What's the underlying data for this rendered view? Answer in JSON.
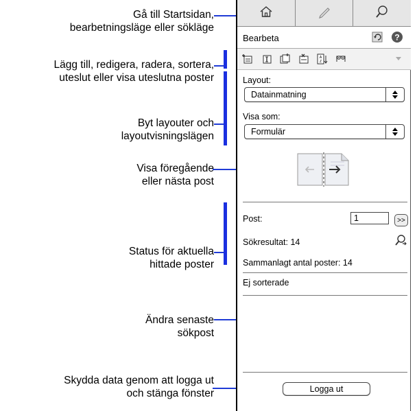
{
  "callouts": {
    "nav": [
      "Gå till Startsidan,",
      "bearbetningsläge eller sökläge"
    ],
    "records": [
      "Lägg till, redigera, radera, sortera,",
      "uteslut eller visa uteslutna poster"
    ],
    "layouts": [
      "Byt layouter och",
      "layoutvisningslägen"
    ],
    "book": [
      "Visa föregående",
      "eller nästa post"
    ],
    "status": [
      "Status för aktuella",
      "hittade poster"
    ],
    "modify": [
      "Ändra senaste",
      "sökpost"
    ],
    "logout": [
      "Skydda data genom att logga ut",
      "och stänga fönster"
    ]
  },
  "nav": {
    "icons": [
      "home-icon",
      "pencil-icon",
      "magnifier-icon"
    ]
  },
  "header": {
    "title": "Bearbeta",
    "icons": [
      "refresh-icon",
      "help-icon"
    ]
  },
  "toolbar": {
    "icons": [
      "new-record-icon",
      "edit-record-icon",
      "duplicate-record-icon",
      "delete-record-icon",
      "sort-icon",
      "show-omitted-icon",
      "menu-arrow-icon"
    ]
  },
  "layout": {
    "label": "Layout:",
    "value": "Datainmatning"
  },
  "view": {
    "label": "Visa som:",
    "value": "Formulär"
  },
  "status": {
    "post_label": "Post:",
    "post_value": "1",
    "go_label": ">>",
    "found": "Sökresultat: 14",
    "total": "Sammanlagt antal poster: 14",
    "sort": "Ej sorterade"
  },
  "logout_label": "Logga ut",
  "colors": {
    "callout_line": "#1f3bd6",
    "callout_bar": "#1a2fe0"
  }
}
